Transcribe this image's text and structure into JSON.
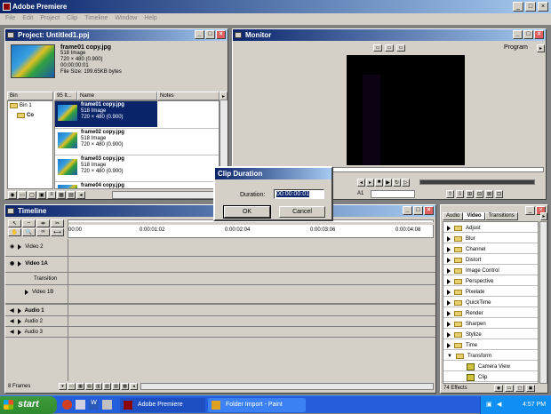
{
  "app": {
    "title": "Adobe Premiere"
  },
  "menu": [
    "File",
    "Edit",
    "Project",
    "Clip",
    "Timeline",
    "Window",
    "Help"
  ],
  "project": {
    "title": "Project: Untitled1.ppj",
    "preview": {
      "name": "frame01 copy.jpg",
      "type": "518 Image",
      "dims": "720 × 480 (0.900)",
      "tc": "00;00;00:01",
      "size": "File Size: 199.65KB bytes"
    },
    "bin_header": "Bin",
    "col_count": "95 It...",
    "col_name": "Name",
    "col_notes": "Notes",
    "bins": [
      "Bin 1",
      "Co"
    ],
    "clips": [
      {
        "name": "frame01 copy.jpg",
        "type": "518 Image",
        "dims": "720 × 480 (0.900)"
      },
      {
        "name": "frame02 copy.jpg",
        "type": "518 Image",
        "dims": "720 × 480 (0.900)"
      },
      {
        "name": "frame03 copy.jpg",
        "type": "518 Image",
        "dims": "720 × 480 (0.900)"
      },
      {
        "name": "frame04 copy.jpg",
        "type": "518 Image",
        "dims": ""
      }
    ]
  },
  "monitor": {
    "title": "Monitor",
    "program": "Program",
    "track": "A1"
  },
  "dialog": {
    "title": "Clip Duration",
    "label": "Duration:",
    "value": "00:00:00:01",
    "ok": "OK",
    "cancel": "Cancel"
  },
  "timeline": {
    "title": "Timeline",
    "ruler": [
      "00:00",
      "0:00:01:02",
      "0:00:02:04",
      "0:00:03:06",
      "0:00:04:08"
    ],
    "tracks": [
      "Video 2",
      "Video 1A",
      "Transition",
      "Video 1B",
      "Audio 1",
      "Audio 2",
      "Audio 3"
    ],
    "footer": "8 Frames"
  },
  "effects": {
    "tabs": [
      "Audio",
      "Video",
      "Transitions"
    ],
    "items": [
      "Adjust",
      "Blur",
      "Channel",
      "Distort",
      "Image Control",
      "Perspective",
      "Pixelate",
      "QuickTime",
      "Render",
      "Sharpen",
      "Stylize",
      "Time",
      "Transform"
    ],
    "subitems": [
      "Camera View",
      "Clip"
    ],
    "count": "74 Effects"
  },
  "taskbar": {
    "start": "start",
    "buttons": [
      "Adobe Premiere",
      "Folder Import - Paint"
    ],
    "clock": "4:57 PM"
  }
}
